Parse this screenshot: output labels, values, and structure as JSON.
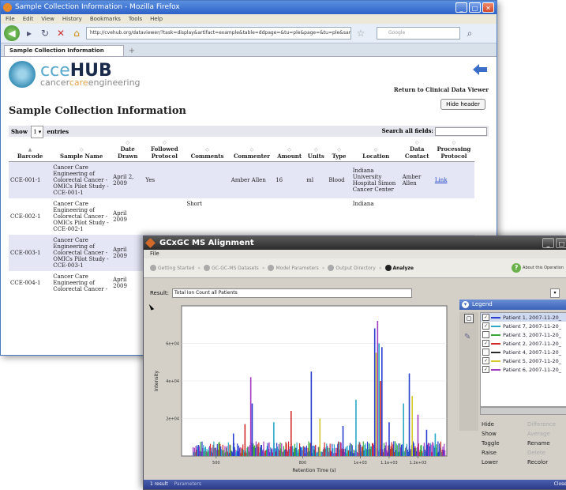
{
  "firefox": {
    "window_title": "Sample Collection Information - Mozilla Firefox",
    "menu": [
      "File",
      "Edit",
      "View",
      "History",
      "Bookmarks",
      "Tools",
      "Help"
    ],
    "url": "http://cvehub.org/dataviewer/?task=display&artifact=example&table=ddpage=&tu=ple&page=&tu=ple&sample_se",
    "search_placeholder": "Google",
    "tab_label": "Sample Collection Information",
    "brand": {
      "cce": "cce",
      "hub": "HUB",
      "sub_a": "cancer",
      "sub_b": "care",
      "sub_c": "engineering"
    },
    "return_link": "Return to Clinical Data Viewer",
    "hide_header": "Hide header",
    "page_title": "Sample Collection Information",
    "show_label": "Show",
    "show_value": "1",
    "entries_label": "entries",
    "search_all_label": "Search all fields:",
    "columns": [
      "Barcode",
      "Sample Name",
      "Date Drawn",
      "Followed Protocol",
      "Comments",
      "Commenter",
      "Amount",
      "Units",
      "Type",
      "Location",
      "Data Contact",
      "Processing Protocol"
    ],
    "rows": [
      {
        "barcode": "CCE-001-1",
        "name": "Cancer Care Engineering of Colorectal Cancer - OMICs Pilot Study - CCE-001-1",
        "date": "April 2, 2009",
        "protocol": "Yes",
        "comments": "",
        "commenter": "Amber Allen",
        "amount": "16",
        "units": "ml",
        "type": "Blood",
        "location": "Indiana University Hospital Simon Cancer Center",
        "contact": "Amber Allen",
        "processing": "Link"
      },
      {
        "barcode": "CCE-002-1",
        "name": "Cancer Care Engineering of Colorectal Cancer - OMICs Pilot Study - CCE-002-1",
        "date": "April 2009",
        "protocol": "",
        "comments": "Short",
        "commenter": "",
        "amount": "",
        "units": "",
        "type": "",
        "location": "Indiana",
        "contact": "",
        "processing": ""
      },
      {
        "barcode": "CCE-003-1",
        "name": "Cancer Care Engineering of Colorectal Cancer - OMICs Pilot Study - CCE-003-1",
        "date": "April 2009",
        "protocol": "",
        "comments": "",
        "commenter": "",
        "amount": "",
        "units": "",
        "type": "",
        "location": "",
        "contact": "",
        "processing": ""
      },
      {
        "barcode": "CCE-004-1",
        "name": "Cancer Care Engineering of Colorectal Cancer -",
        "date": "April 2009",
        "protocol": "",
        "comments": "",
        "commenter": "",
        "amount": "",
        "units": "",
        "type": "",
        "location": "",
        "contact": "",
        "processing": ""
      }
    ]
  },
  "gcxgc": {
    "window_title": "GCxGC MS Alignment",
    "file_menu": "File",
    "steps": [
      "Getting Started",
      "GC-GC-MS Datasets",
      "Model Parameters",
      "Output Directory",
      "Analyze"
    ],
    "about": "About this Operation",
    "result_label": "Result:",
    "result_value": "Total Ion Count all Patients",
    "legend_title": "Legend",
    "legend_items": [
      {
        "label": "Patient 1, 2007-11-20_",
        "color": "#2a3fd0",
        "checked": true,
        "selected": true
      },
      {
        "label": "Patient 7, 2007-11-20_",
        "color": "#2aa8c8",
        "checked": true,
        "selected": false
      },
      {
        "label": "Patient 3, 2007-11-20_",
        "color": "#3aa83a",
        "checked": false,
        "selected": false
      },
      {
        "label": "Patient 2, 2007-11-20_",
        "color": "#d02a2a",
        "checked": true,
        "selected": false
      },
      {
        "label": "Patient 4, 2007-11-20_",
        "color": "#2a2a2a",
        "checked": false,
        "selected": false
      },
      {
        "label": "Patient 5, 2007-11-20_",
        "color": "#d8c82a",
        "checked": true,
        "selected": false
      },
      {
        "label": "Patient 6, 2007-11-20_",
        "color": "#a03ac0",
        "checked": true,
        "selected": false
      }
    ],
    "actions": {
      "hide": "Hide",
      "show": "Show",
      "toggle": "Toggle",
      "raise": "Raise",
      "lower": "Lower",
      "difference": "Difference",
      "average": "Average",
      "rename": "Rename",
      "delete": "Delete",
      "recolor": "Recolor"
    },
    "status": {
      "count": "1 result",
      "extra": "Parameters",
      "right": "Close"
    },
    "colors": {
      "blue": "#2a3fd0",
      "cyan": "#2aa8c8",
      "red": "#d02a2a",
      "yellow": "#d8c82a",
      "purple": "#a03ac0"
    }
  },
  "chart_data": {
    "type": "bar",
    "title": "",
    "xlabel": "Retention Time (s)",
    "ylabel": "Intensity",
    "xlim": [
      380,
      1300
    ],
    "ylim": [
      0,
      80000
    ],
    "xticks": [
      "500",
      "800",
      "1e+03",
      "1.1e+03",
      "1.2e+03"
    ],
    "xtick_values": [
      500,
      800,
      1000,
      1100,
      1200
    ],
    "yticks": [
      "2e+04",
      "4e+04",
      "6e+04"
    ],
    "ytick_values": [
      20000,
      40000,
      60000
    ],
    "peaks": [
      {
        "x": 560,
        "y": 12000,
        "color": "#2a3fd0"
      },
      {
        "x": 600,
        "y": 17000,
        "color": "#d02a2a"
      },
      {
        "x": 620,
        "y": 42000,
        "color": "#a03ac0"
      },
      {
        "x": 625,
        "y": 28000,
        "color": "#2a3fd0"
      },
      {
        "x": 700,
        "y": 18000,
        "color": "#2aa8c8"
      },
      {
        "x": 760,
        "y": 24000,
        "color": "#d02a2a"
      },
      {
        "x": 830,
        "y": 45000,
        "color": "#2a3fd0"
      },
      {
        "x": 860,
        "y": 20000,
        "color": "#d8c82a"
      },
      {
        "x": 940,
        "y": 16000,
        "color": "#2a3fd0"
      },
      {
        "x": 985,
        "y": 30000,
        "color": "#2aa8c8"
      },
      {
        "x": 1050,
        "y": 68000,
        "color": "#2a3fd0"
      },
      {
        "x": 1055,
        "y": 55000,
        "color": "#d8c82a"
      },
      {
        "x": 1060,
        "y": 72000,
        "color": "#a03ac0"
      },
      {
        "x": 1065,
        "y": 60000,
        "color": "#2aa8c8"
      },
      {
        "x": 1070,
        "y": 40000,
        "color": "#d02a2a"
      },
      {
        "x": 1075,
        "y": 58000,
        "color": "#2a3fd0"
      },
      {
        "x": 1100,
        "y": 18000,
        "color": "#2a3fd0"
      },
      {
        "x": 1150,
        "y": 28000,
        "color": "#2aa8c8"
      },
      {
        "x": 1170,
        "y": 44000,
        "color": "#2a3fd0"
      },
      {
        "x": 1180,
        "y": 32000,
        "color": "#d8c82a"
      },
      {
        "x": 1200,
        "y": 22000,
        "color": "#a03ac0"
      },
      {
        "x": 1230,
        "y": 14000,
        "color": "#2a3fd0"
      },
      {
        "x": 1260,
        "y": 12000,
        "color": "#2aa8c8"
      }
    ]
  }
}
